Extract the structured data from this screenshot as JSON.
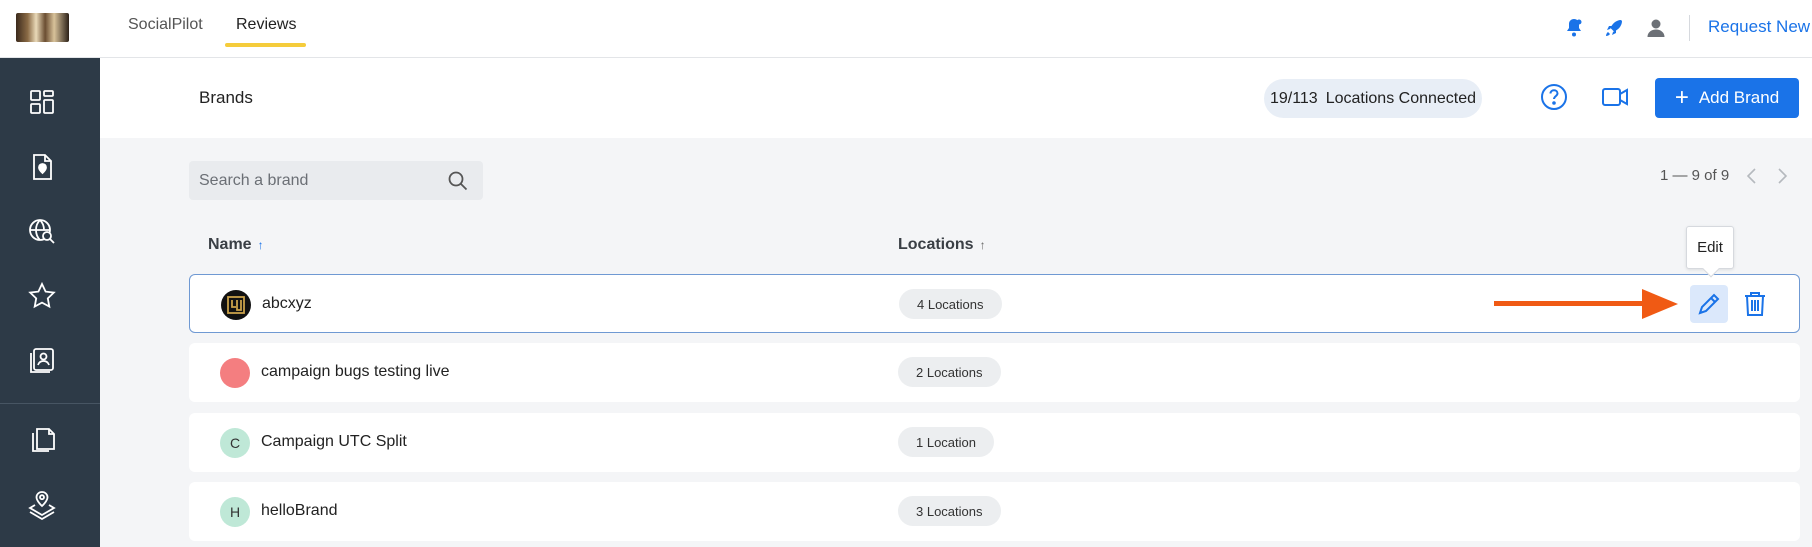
{
  "top_nav": {
    "tabs": [
      {
        "label": "SocialPilot",
        "active": false
      },
      {
        "label": "Reviews",
        "active": true
      }
    ],
    "icons": [
      "notification-bell-icon",
      "rocket-icon",
      "user-icon"
    ],
    "request_link": "Request New F"
  },
  "sidebar": {
    "items": [
      "dashboard-icon",
      "location-document-icon",
      "global-search-icon",
      "star-icon",
      "contacts-icon",
      "copy-pages-icon",
      "map-layers-icon"
    ]
  },
  "header": {
    "title": "Brands",
    "locations_connected": "19/113",
    "locations_label": "Locations Connected",
    "add_brand_label": "Add Brand"
  },
  "search": {
    "placeholder": "Search a brand"
  },
  "pagination": {
    "text": "1 — 9 of 9"
  },
  "table": {
    "columns": [
      {
        "label": "Name",
        "sort": "↑"
      },
      {
        "label": "Locations",
        "sort": "↑"
      }
    ],
    "rows": [
      {
        "name": "abcxyz",
        "avatar": "logo",
        "locations": "4 Locations"
      },
      {
        "name": "campaign bugs testing live",
        "avatar": "",
        "avatar_color": "#f47e80",
        "locations": "2 Locations"
      },
      {
        "name": "Campaign UTC Split",
        "avatar": "C",
        "avatar_color": "#bfe8d7",
        "locations": "1 Location"
      },
      {
        "name": "helloBrand",
        "avatar": "H",
        "avatar_color": "#bfe8d7",
        "locations": "3 Locations"
      }
    ]
  },
  "tooltip": {
    "text": "Edit"
  },
  "colors": {
    "accent": "#1a73e8",
    "sidebar": "#2d3a47",
    "tab_underline": "#f5cc3b",
    "annotation_arrow": "#f05a14"
  }
}
